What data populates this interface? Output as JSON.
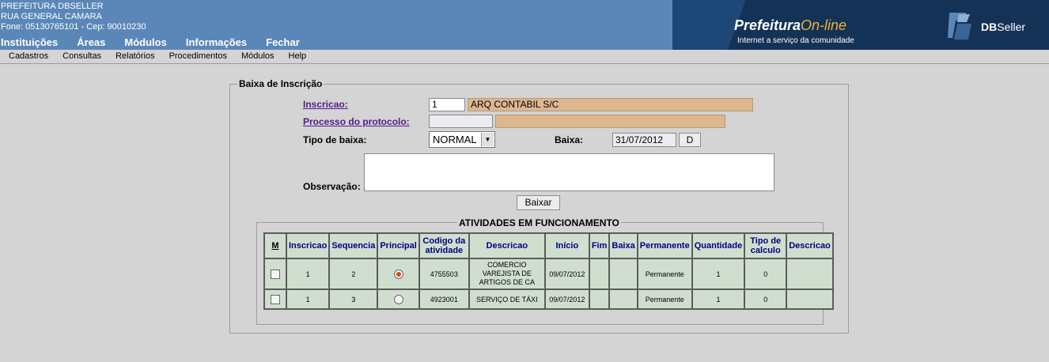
{
  "header": {
    "org_name": "PREFEITURA DBSELLER",
    "address": "RUA GENERAL CAMARA",
    "contact": "Fone: 05130765101  -  Cep: 90010230",
    "menu": [
      "Instituições",
      "Áreas",
      "Módulos",
      "Informações",
      "Fechar"
    ],
    "banner_prefeitura": "Prefeitura",
    "banner_online": "On-line",
    "banner_subtitle": "Internet a serviço da comunidade",
    "brand_db": "DB",
    "brand_seller": "Seller"
  },
  "submenu": [
    "Cadastros",
    "Consultas",
    "Relatórios",
    "Procedimentos",
    "Módulos",
    "Help"
  ],
  "form": {
    "legend": "Baixa de Inscrição",
    "inscricao_label": "Inscricao:",
    "inscricao_value": "1",
    "inscricao_name": "ARQ CONTABIL S/C",
    "processo_label": "Processo do protocolo:",
    "processo_value": "",
    "processo_desc": "",
    "tipo_label": "Tipo de baixa:",
    "tipo_value": "NORMAL",
    "baixa_label": "Baixa:",
    "baixa_date": "31/07/2012",
    "baixa_btn": "D",
    "obs_label": "Observação:",
    "obs_value": "",
    "submit_label": "Baixar"
  },
  "activities": {
    "legend": "ATIVIDADES EM FUNCIONAMENTO",
    "columns": [
      "M",
      "Inscricao",
      "Sequencia",
      "Principal",
      "Codigo da atividade",
      "Descricao",
      "Início",
      "Fim",
      "Baixa",
      "Permanente",
      "Quantidade",
      "Tipo de calculo",
      "Descricao"
    ],
    "rows": [
      {
        "checked": false,
        "inscricao": "1",
        "sequencia": "2",
        "principal": true,
        "codigo": "4755503",
        "descricao": "COMERCIO VAREJISTA DE ARTIGOS DE CA",
        "inicio": "09/07/2012",
        "fim": "",
        "baixa": "",
        "permanente": "Permanente",
        "quantidade": "1",
        "tipo_calculo": "0",
        "descricao2": ""
      },
      {
        "checked": false,
        "inscricao": "1",
        "sequencia": "3",
        "principal": false,
        "codigo": "4923001",
        "descricao": "SERVIÇO DE TÁXI",
        "inicio": "09/07/2012",
        "fim": "",
        "baixa": "",
        "permanente": "Permanente",
        "quantidade": "1",
        "tipo_calculo": "0",
        "descricao2": ""
      }
    ]
  },
  "colors": {
    "header_bg": "#5b87b8",
    "banner_bg": "#143256",
    "table_cell_bg": "#d0ded0",
    "table_header_text": "#000080",
    "readonly_tan": "#ddb790"
  }
}
